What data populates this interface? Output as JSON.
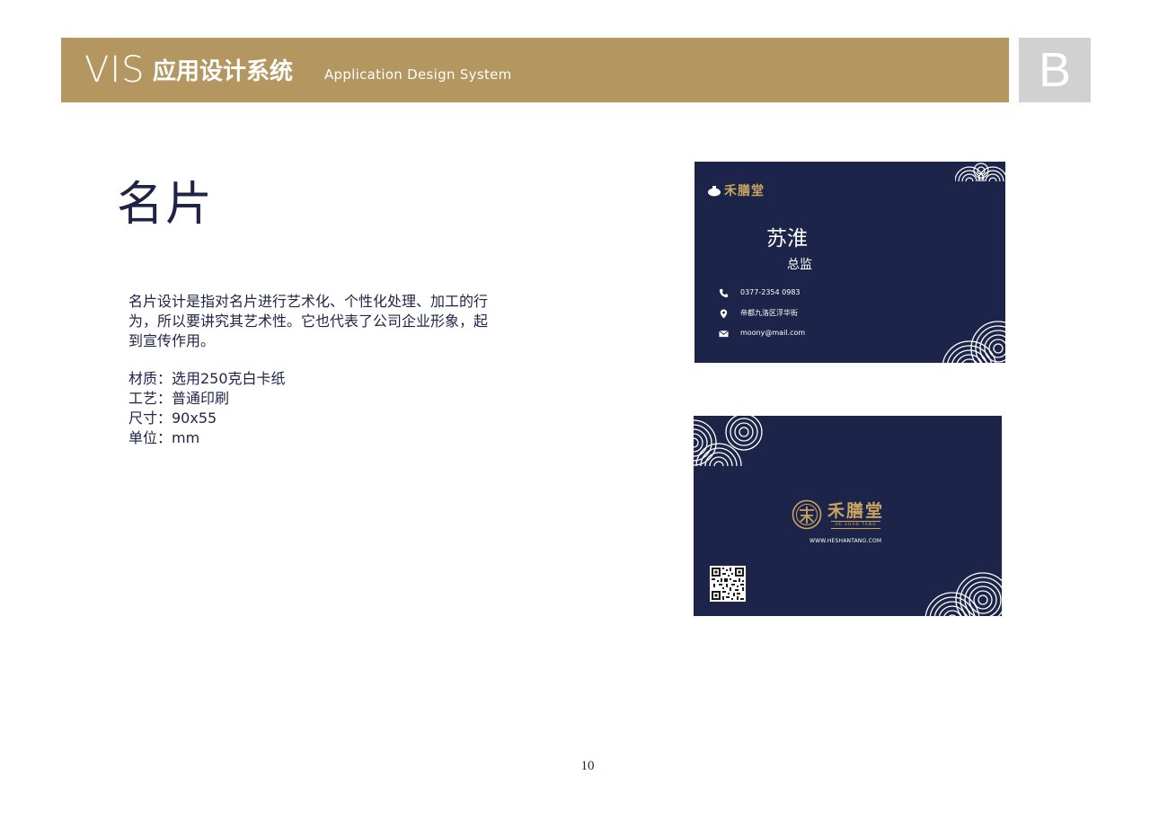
{
  "header": {
    "vis_label": "VIS",
    "title_cn": "应用设计系统",
    "title_en": "Application Design System",
    "section_letter": "B",
    "bar_color": "#b39660"
  },
  "main": {
    "heading": "名片",
    "description": "名片设计是指对名片进行艺术化、个性化处理、加工的行为，所以要讲究其艺术性。它也代表了公司企业形象，起到宣传作用。",
    "specs": [
      "材质：选用250克白卡纸",
      "工艺：普通印刷",
      "尺寸：90x55",
      "单位：mm"
    ]
  },
  "card_front": {
    "brand": "禾膳堂",
    "name": "苏淮",
    "title": "总监",
    "phone": "0377-2354 0983",
    "address": "帝都九洛区浮华街",
    "email": "moony@mail.com",
    "icons": [
      "phone-icon",
      "location-pin-icon",
      "mail-icon"
    ],
    "background_color": "#1d2449",
    "accent_color": "#c9a362"
  },
  "card_back": {
    "brand": "禾膳堂",
    "brand_en": "HE SHAN TANG",
    "url": "WWW.HESHANTANG.COM",
    "icons": [
      "brand-emblem-icon",
      "qr-code"
    ]
  },
  "footer": {
    "page_number": "10"
  }
}
